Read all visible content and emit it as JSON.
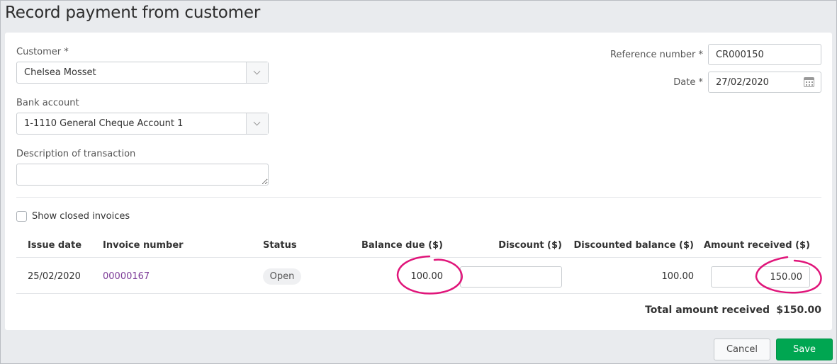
{
  "page": {
    "title": "Record payment from customer"
  },
  "form": {
    "customer": {
      "label": "Customer *",
      "value": "Chelsea Mosset"
    },
    "bank_account": {
      "label": "Bank account",
      "value": "1-1110 General Cheque Account 1"
    },
    "description": {
      "label": "Description of transaction",
      "value": ""
    },
    "reference_number": {
      "label": "Reference number *",
      "value": "CR000150"
    },
    "date": {
      "label": "Date *",
      "value": "27/02/2020"
    },
    "show_closed": {
      "label": "Show closed invoices",
      "checked": false
    }
  },
  "table": {
    "headers": {
      "issue_date": "Issue date",
      "invoice_number": "Invoice number",
      "status": "Status",
      "balance_due": "Balance due ($)",
      "discount": "Discount ($)",
      "discounted_balance": "Discounted balance ($)",
      "amount_received": "Amount received ($)"
    },
    "rows": [
      {
        "issue_date": "25/02/2020",
        "invoice_number": "00000167",
        "status": "Open",
        "balance_due": "100.00",
        "discount": "",
        "discounted_balance": "100.00",
        "amount_received": "150.00"
      }
    ],
    "total_label": "Total amount received",
    "total_value": "$150.00"
  },
  "actions": {
    "cancel": "Cancel",
    "save": "Save"
  },
  "colors": {
    "accent_save": "#00a651",
    "annotation": "#e0157a",
    "link": "#7d3c98"
  }
}
